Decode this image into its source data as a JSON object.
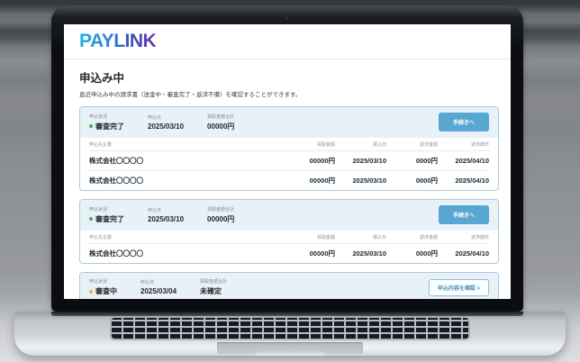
{
  "app": {
    "logo": "PAYLINK",
    "page_title": "申込み中",
    "page_subtitle": "直近申込み中の請求書（送金中・審査完了・返済不備）を確認することができます。"
  },
  "labels": {
    "status": "申込状況",
    "apply_date": "申込日",
    "purchase_total": "買取金額合計",
    "company": "申込先企業",
    "purchase_amount": "買取金額",
    "transfer_date": "振込日",
    "repayment_amount": "返済金額",
    "repayment_due": "返済期日"
  },
  "colors": {
    "accent_blue": "#57a7d2",
    "status_green": "#3cb54a",
    "status_yellow": "#f2ac3c",
    "card_header_bg": "#e8f1f7",
    "card_border": "#a9cbde"
  },
  "cards": [
    {
      "status": "審査完了",
      "status_color": "#3cb54a",
      "apply_date": "2025/03/10",
      "purchase_total": "00000円",
      "action": "手続きへ",
      "rows": [
        {
          "company": "株式会社〇〇〇〇",
          "purchase": "00000円",
          "transfer": "2025/03/10",
          "repay": "0000円",
          "due": "2025/04/10"
        },
        {
          "company": "株式会社〇〇〇〇",
          "purchase": "00000円",
          "transfer": "2025/03/10",
          "repay": "0000円",
          "due": "2025/04/10"
        }
      ]
    },
    {
      "status": "審査完了",
      "status_color": "#3cb54a",
      "apply_date": "2025/03/10",
      "purchase_total": "00000円",
      "action": "手続きへ",
      "rows": [
        {
          "company": "株式会社〇〇〇〇",
          "purchase": "00000円",
          "transfer": "2025/03/10",
          "repay": "0000円",
          "due": "2025/04/10"
        }
      ]
    },
    {
      "status": "審査中",
      "status_color": "#f2ac3c",
      "apply_date": "2025/03/04",
      "purchase_total": "未確定",
      "action": "申込内容を確認 >",
      "rows": []
    }
  ]
}
